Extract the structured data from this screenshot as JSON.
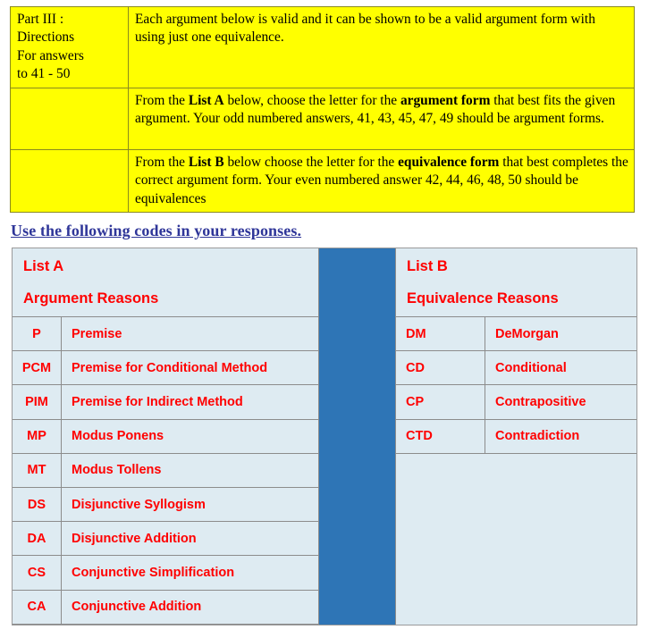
{
  "directions": {
    "rows": [
      {
        "label": "Part III :\nDirections\nFor answers\nto 41 - 50",
        "body_html": "Each argument below is valid and it can be shown to be a valid argument form with using just one equivalence.",
        "body_plain": "Each argument below is valid and it can be shown to be a valid argument form with using just one equivalence."
      },
      {
        "label": "",
        "body_plain": "From the List A below, choose the letter for the argument form that best fits the given argument.  Your odd numbered answers,  41,  43, 45, 47, 49 should be argument forms."
      },
      {
        "label": "",
        "body_plain": "From the List  B below choose the letter for the equivalence form that best completes the correct argument form.  Your even numbered answer 42, 44, 46, 48, 50 should be equivalences"
      }
    ],
    "row1_label_lines": [
      "Part III :",
      "Directions",
      "For answers",
      "to 41 - 50"
    ],
    "row2_segments": [
      {
        "text": "From the ",
        "bold": false
      },
      {
        "text": "List A",
        "bold": true
      },
      {
        "text": " below, choose the letter for the ",
        "bold": false
      },
      {
        "text": "argument form",
        "bold": true
      },
      {
        "text": " that best fits the given argument.  Your odd numbered answers,  41,  43, 45, 47, 49 should be argument forms.",
        "bold": false
      }
    ],
    "row3_segments": [
      {
        "text": "From the ",
        "bold": false
      },
      {
        "text": "List  B",
        "bold": true
      },
      {
        "text": " below choose the letter for the ",
        "bold": false
      },
      {
        "text": "equivalence form",
        "bold": true
      },
      {
        "text": " that best completes the correct argument form.  Your even numbered answer 42, 44, 46, 48, 50 should be equivalences",
        "bold": false
      }
    ]
  },
  "codes_heading": "Use the following codes in your responses.",
  "list_a": {
    "title": "List A",
    "subtitle": "Argument Reasons",
    "rows": [
      {
        "code": "P",
        "name": "Premise"
      },
      {
        "code": "PCM",
        "name": "Premise for Conditional Method"
      },
      {
        "code": "PIM",
        "name": "Premise for Indirect Method"
      },
      {
        "code": "MP",
        "name": "Modus Ponens"
      },
      {
        "code": "MT",
        "name": "Modus Tollens"
      },
      {
        "code": "DS",
        "name": "Disjunctive Syllogism"
      },
      {
        "code": "DA",
        "name": "Disjunctive Addition"
      },
      {
        "code": "CS",
        "name": "Conjunctive Simplification"
      },
      {
        "code": "CA",
        "name": "Conjunctive Addition"
      }
    ]
  },
  "list_b": {
    "title": "List B",
    "subtitle": "Equivalence Reasons",
    "rows": [
      {
        "code": "DM",
        "name": "DeMorgan"
      },
      {
        "code": "CD",
        "name": "Conditional"
      },
      {
        "code": "CP",
        "name": "Contrapositive"
      },
      {
        "code": "CTD",
        "name": "Contradiction"
      }
    ]
  },
  "colors": {
    "directions_background": "#ffff00",
    "directions_text": "#000000",
    "heading_text": "#2f3699",
    "table_background": "#deebf2",
    "table_text": "#ff0000",
    "divider_column": "#2e75b6",
    "grid_line": "#8c8c8c"
  }
}
